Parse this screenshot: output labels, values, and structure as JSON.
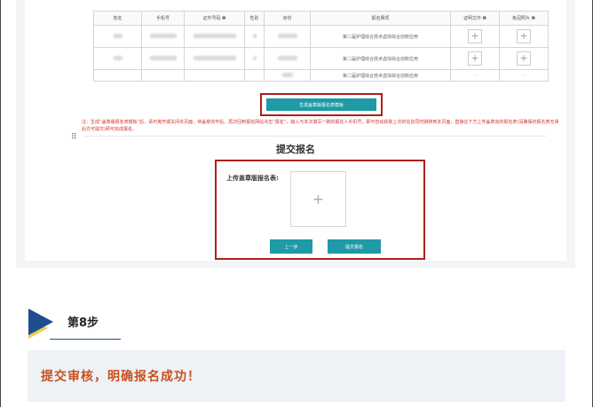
{
  "table": {
    "headers": [
      "姓名",
      "手机号",
      "证件号码 ❷",
      "性别",
      "身份",
      "报名赛项",
      "证明文件 ❷",
      "免冠照片 ❷"
    ],
    "rows": [
      {
        "event": "第二届护理综合技术虚拟综合创新应用",
        "cert": "+",
        "photo": "+"
      },
      {
        "event": "第二届护理综合技术虚拟综合创新应用",
        "cert": "+",
        "photo": "+"
      },
      {
        "event": "第二届护理综合技术虚拟综合创新应用",
        "cert": "—",
        "photo": "—"
      }
    ]
  },
  "generate_button": "生成盖章版报名表模板",
  "note": "注：生成“盖章版报名表模板”后，请可离开或关闭本页面，待盖章完毕后，再次回到报名网站点击“报名”，输入与本次填写一致的报名人手机号，即可自动获取上次的信息同时跳转到本页面，直接在下方上传盖章完的报名表(请确保的报名表无误后方可提交)即可完成报名。",
  "submit": {
    "title": "提交报名",
    "upload_label": "上传盖章版报名表:",
    "upload_plus": "+",
    "prev_button": "上一步",
    "submit_button": "提交报名"
  },
  "step": {
    "label": "第8步",
    "icon": "play-triangle-icon"
  },
  "result": {
    "text": "提交审核，明确报名成功！"
  },
  "colors": {
    "accent": "#1f9aa6",
    "highlight_frame": "#b01d1d",
    "note_text": "#d9322b",
    "result_text": "#c8511f",
    "step_blue": "#1e4e8c",
    "step_yellow": "#f2c94c"
  }
}
